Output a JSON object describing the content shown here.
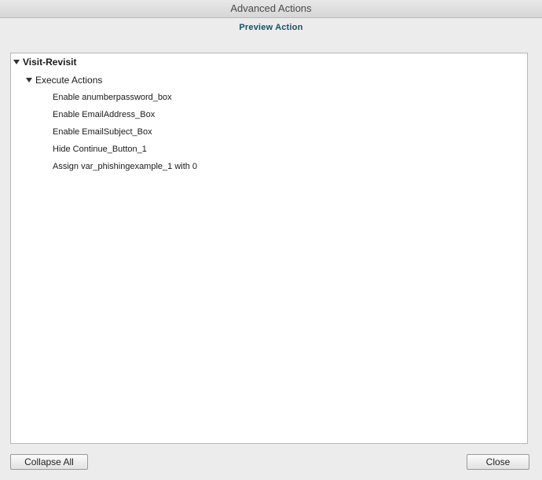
{
  "window": {
    "title": "Advanced Actions",
    "subtitle": "Preview Action"
  },
  "tree": {
    "root": {
      "label": "Visit-Revisit",
      "icon": "triangle-down-icon"
    },
    "group": {
      "label": "Execute Actions",
      "icon": "triangle-down-icon"
    },
    "actions": [
      "Enable anumberpassword_box",
      "Enable EmailAddress_Box",
      "Enable EmailSubject_Box",
      "Hide Continue_Button_1",
      "Assign var_phishingexample_1 with 0"
    ]
  },
  "footer": {
    "collapse_label": "Collapse All",
    "close_label": "Close"
  }
}
